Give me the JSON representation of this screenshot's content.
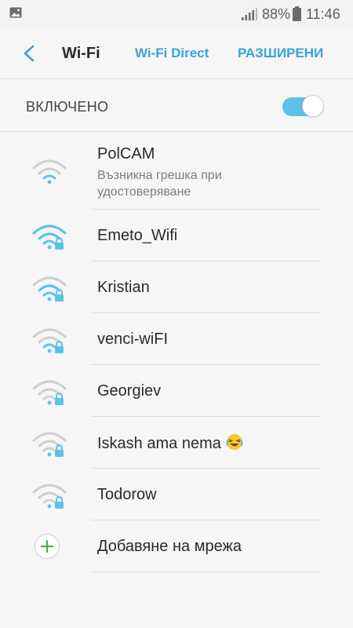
{
  "status_bar": {
    "battery_percent": "88%",
    "time": "11:46",
    "icons": [
      "gallery-icon",
      "signal-icon",
      "battery-icon"
    ]
  },
  "header": {
    "title": "Wi-Fi",
    "wifi_direct": "Wi-Fi Direct",
    "advanced": "РАЗШИРЕНИ"
  },
  "toggle": {
    "label": "ВКЛЮЧЕНО",
    "on": true,
    "color": "#5cc2ea"
  },
  "networks": [
    {
      "name": "PolCAM",
      "status": "Възникна грешка при удостоверяване",
      "secured": false
    },
    {
      "name": "Emeto_Wifi",
      "secured": true
    },
    {
      "name": "Kristian",
      "secured": true
    },
    {
      "name": "venci-wiFI",
      "secured": true
    },
    {
      "name": "Georgiev",
      "secured": true
    },
    {
      "name": "Iskash ama nema",
      "secured": true,
      "emoji": "laughing-emoji"
    },
    {
      "name": "Todorow",
      "secured": true
    }
  ],
  "add_network": {
    "label": "Добавяне на мрежа"
  },
  "colors": {
    "accent": "#3aa3d6",
    "wifi_active": "#5cc2ea",
    "wifi_inactive": "#cfcfcf",
    "add_plus": "#4caf50"
  }
}
